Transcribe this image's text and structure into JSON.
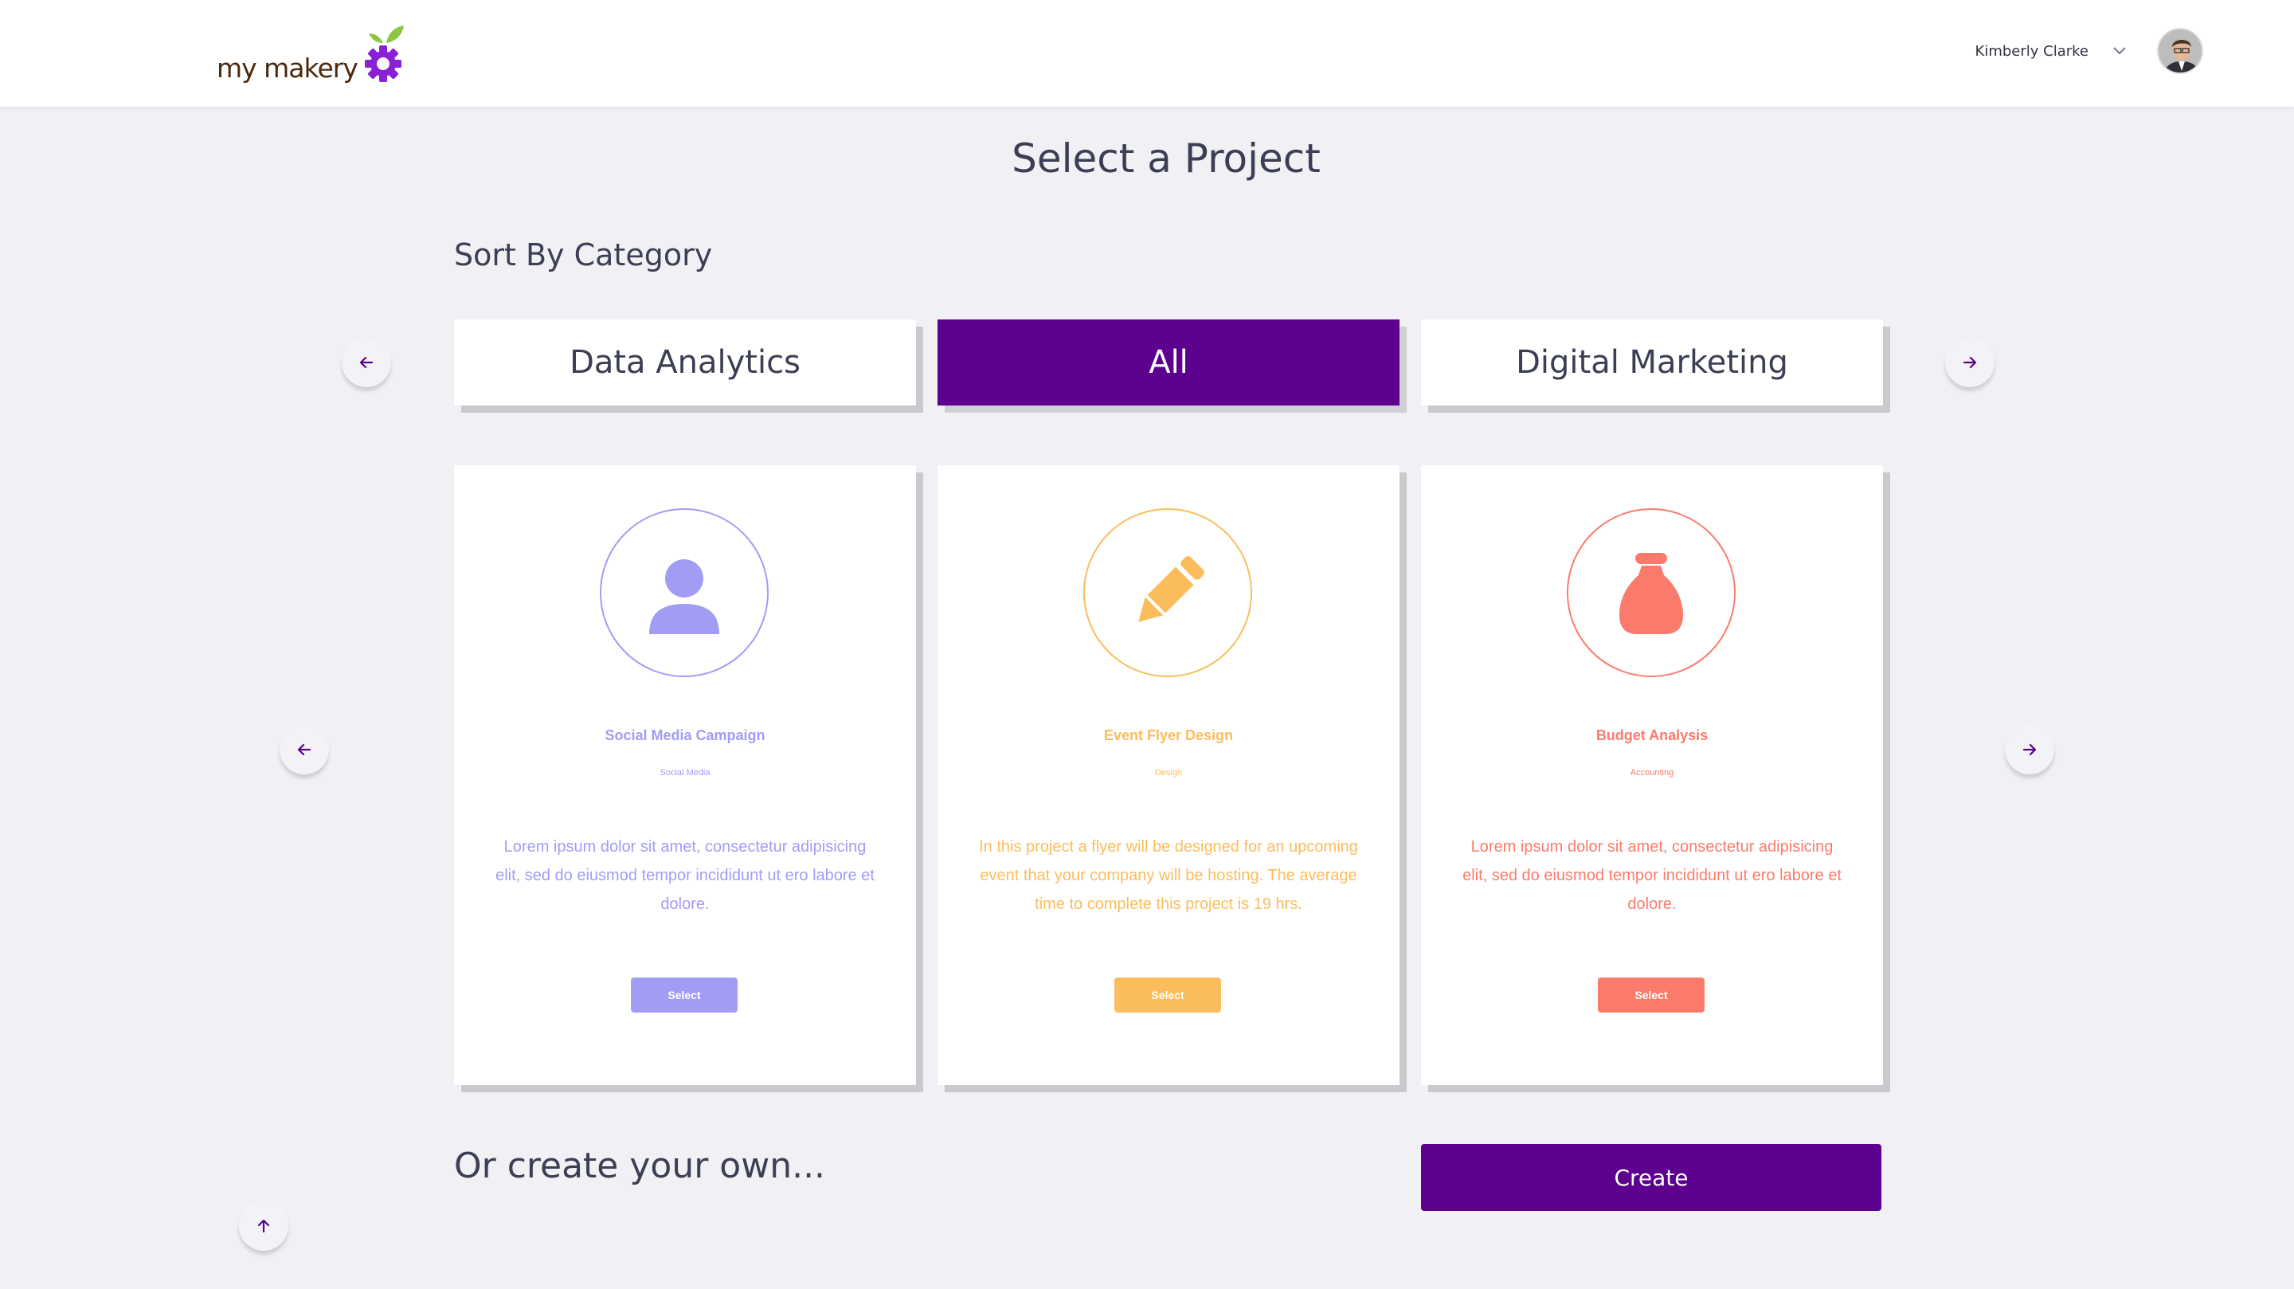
{
  "header": {
    "logo_text": "my makery",
    "user_name": "Kimberly Clarke",
    "chevron_icon": "chevron-down-icon",
    "avatar_icon": "avatar"
  },
  "page": {
    "title": "Select a Project",
    "sort_label": "Sort By Category"
  },
  "categories": {
    "prev_icon": "arrow-left-icon",
    "next_icon": "arrow-right-icon",
    "items": [
      {
        "label": "Data Analytics",
        "active": false
      },
      {
        "label": "All",
        "active": true
      },
      {
        "label": "Digital Marketing",
        "active": false
      }
    ]
  },
  "projects": {
    "prev_icon": "arrow-left-icon",
    "next_icon": "arrow-right-icon",
    "cards": [
      {
        "title": "Social Media Campaign",
        "category": "Social Media",
        "description": "Lorem ipsum dolor sit amet, consectetur adipisicing elit, sed do eiusmod tempor incididunt ut ero labore et dolore.",
        "button": "Select",
        "color": "#a39cf5",
        "icon": "user-icon"
      },
      {
        "title": "Event Flyer Design",
        "category": "Design",
        "description": "In this project a flyer will be designed for an upcoming event that your company will be hosting. The average time to complete this project is 19 hrs.",
        "button": "Select",
        "color": "#fbbd5c",
        "icon": "pencil-icon"
      },
      {
        "title": "Budget Analysis",
        "category": "Accounting",
        "description": "Lorem ipsum dolor sit amet, consectetur adipisicing elit, sed do eiusmod tempor incididunt ut ero labore et dolore.",
        "button": "Select",
        "color": "#fa7b6c",
        "icon": "money-bag-icon"
      }
    ]
  },
  "create": {
    "label": "Or create your own...",
    "button": "Create"
  },
  "scroll_top_icon": "arrow-up-icon",
  "colors": {
    "brand_purple": "#5c008e",
    "background": "#f0f0f5",
    "text": "#3c3f54"
  }
}
